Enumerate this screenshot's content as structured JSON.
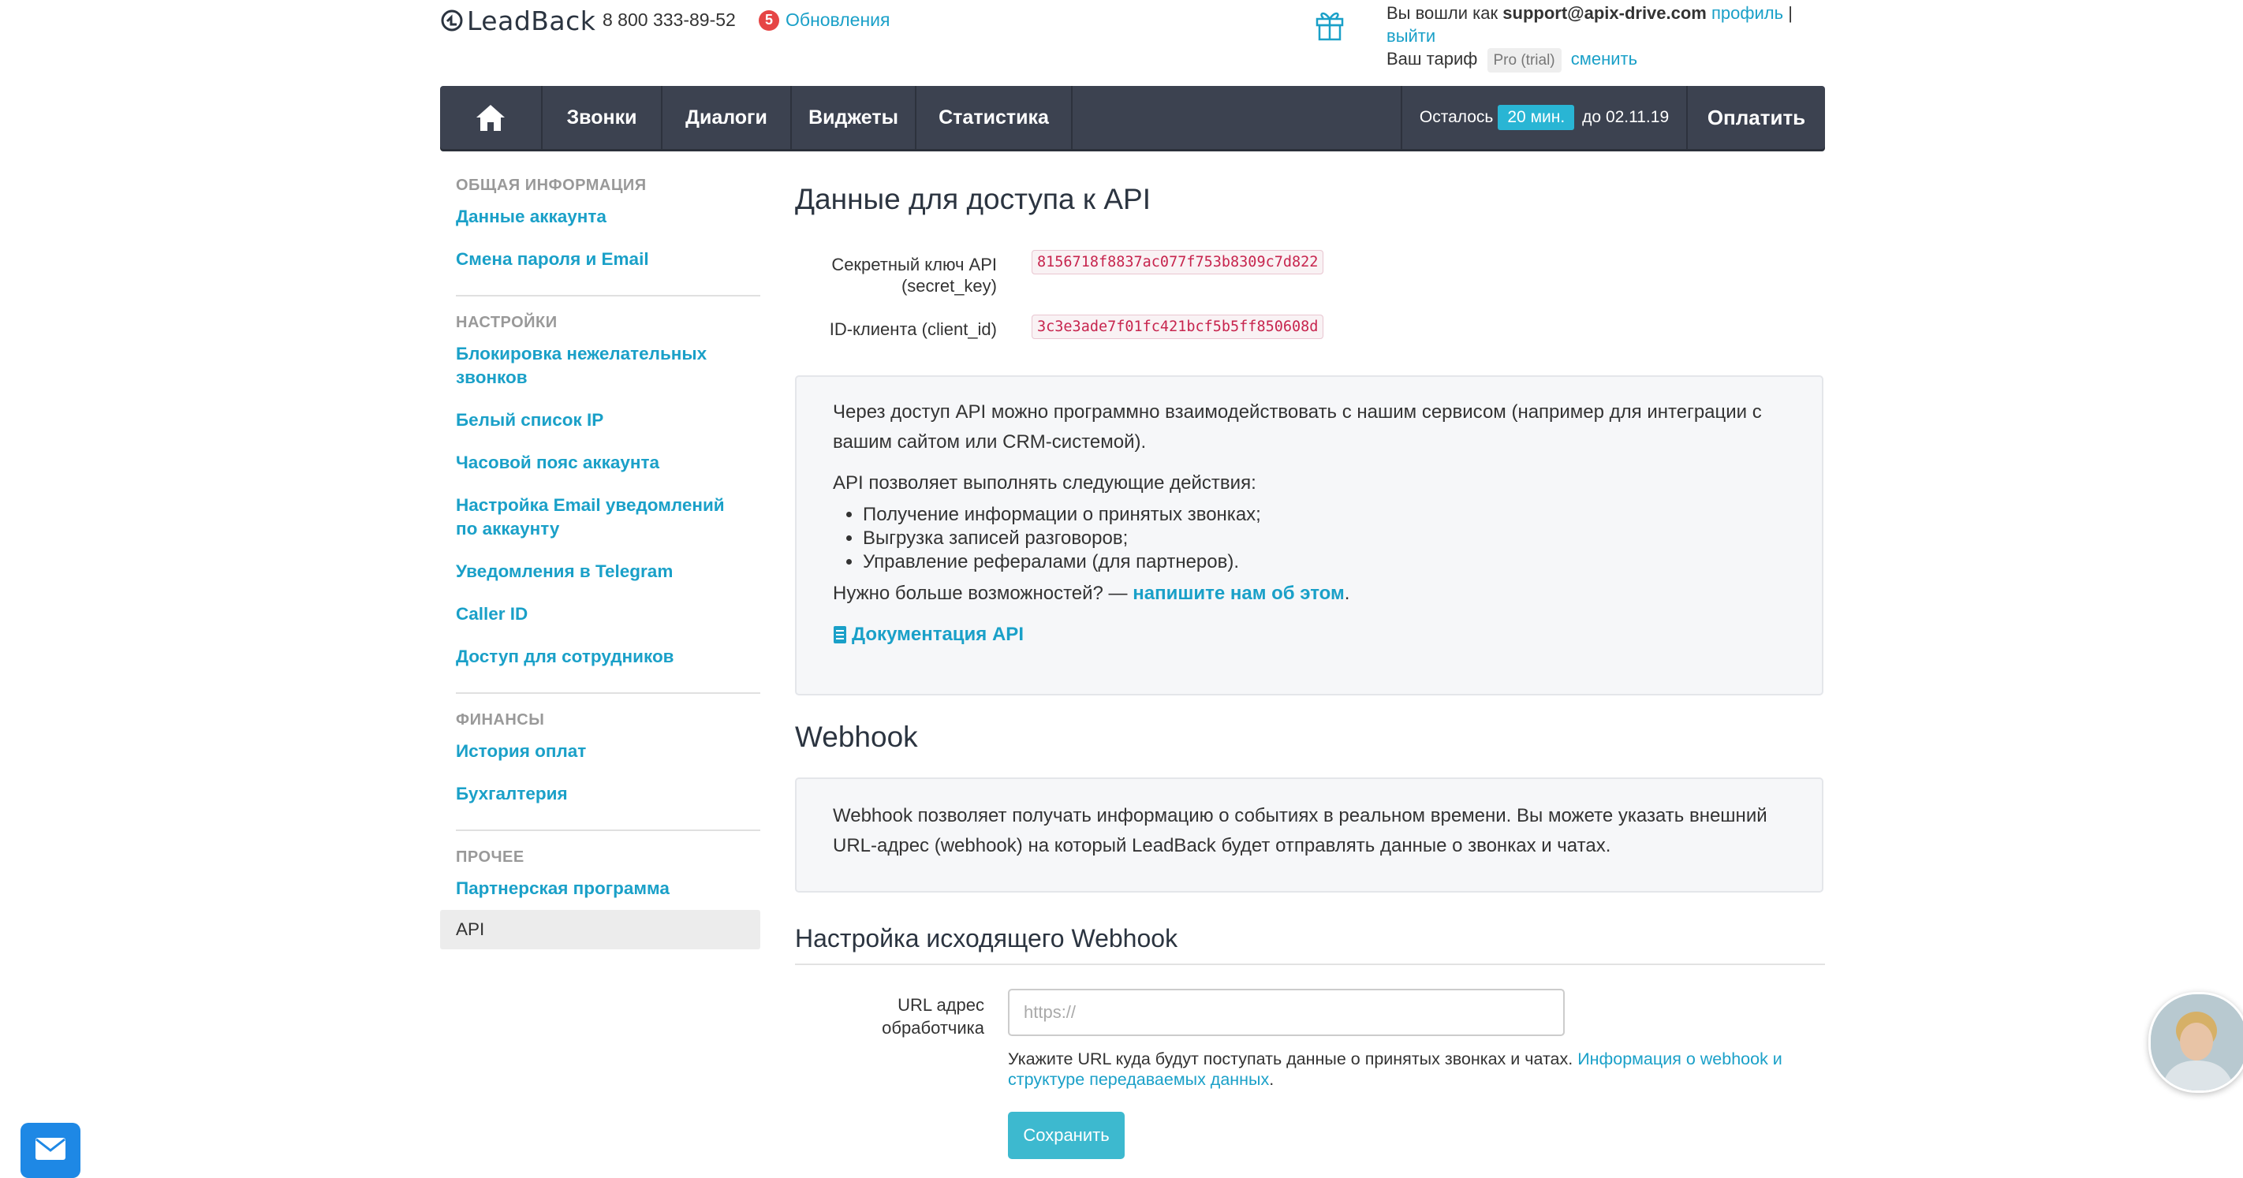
{
  "header": {
    "logo_text": "LeadBack",
    "phone": "8 800 333-89-52",
    "updates_count": "5",
    "updates_label": "Обновления",
    "logged_in_prefix": "Вы вошли как",
    "email": "support@apix-drive.com",
    "profile_link": "профиль",
    "separator": "|",
    "logout_link": "выйти",
    "tariff_label": "Ваш тариф",
    "tariff_value": "Pro (trial)",
    "change_link": "сменить"
  },
  "nav": {
    "items": [
      "Звонки",
      "Диалоги",
      "Виджеты",
      "Статистика"
    ],
    "remaining_label": "Осталось",
    "remaining_value": "20 мин.",
    "until_label": "до 02.11.19",
    "pay_label": "Оплатить"
  },
  "sidebar": {
    "sections": [
      {
        "title": "ОБЩАЯ ИНФОРМАЦИЯ",
        "items": [
          "Данные аккаунта",
          "Смена пароля и Email"
        ]
      },
      {
        "title": "НАСТРОЙКИ",
        "items": [
          "Блокировка нежелательных звонков",
          "Белый список IP",
          "Часовой пояс аккаунта",
          "Настройка Email уведомлений по аккаунту",
          "Уведомления в Telegram",
          "Caller ID",
          "Доступ для сотрудников"
        ]
      },
      {
        "title": "ФИНАНСЫ",
        "items": [
          "История оплат",
          "Бухгалтерия"
        ]
      },
      {
        "title": "ПРОЧЕЕ",
        "items": [
          "Партнерская программа"
        ]
      }
    ],
    "active_item": "API"
  },
  "api": {
    "title": "Данные для доступа к API",
    "secret_label_1": "Секретный ключ API",
    "secret_label_2": "(secret_key)",
    "secret_value": "8156718f8837ac077f753b8309c7d822",
    "client_label": "ID-клиента (client_id)",
    "client_value": "3c3e3ade7f01fc421bcf5b5ff850608d",
    "desc1": "Через доступ API можно программно взаимодействовать с нашим сервисом (например для интеграции с вашим сайтом или CRM-системой).",
    "desc2": "API позволяет выполнять следующие действия:",
    "list": [
      "Получение информации о принятых звонках;",
      "Выгрузка записей разговоров;",
      "Управление рефералами (для партнеров)."
    ],
    "more_prefix": "Нужно больше возможностей? —",
    "more_link": "напишите нам об этом",
    "more_suffix": ".",
    "doc_link": "Документация API"
  },
  "webhook": {
    "title": "Webhook",
    "desc": "Webhook позволяет получать информацию о событиях в реальном времени. Вы можете указать внешний URL-адрес (webhook) на который LeadBack будет отправлять данные о звонках и чатах.",
    "out_title": "Настройка исходящего Webhook",
    "url_label": "URL адрес обработчика",
    "url_placeholder": "https://",
    "url_value": "",
    "hint_text": "Укажите URL куда будут поступать данные о принятых звонках и чатах.",
    "hint_link": "Информация о webhook и структуре передаваемых данных",
    "hint_suffix": ".",
    "save_label": "Сохранить"
  },
  "colors": {
    "accent": "#1aa0c8",
    "nav_bg": "#3c4250",
    "badge": "#29b5d4",
    "mail_button": "#1e88e5"
  },
  "icons": [
    "logo-icon",
    "gift-icon",
    "home-icon",
    "document-icon",
    "mail-icon"
  ]
}
